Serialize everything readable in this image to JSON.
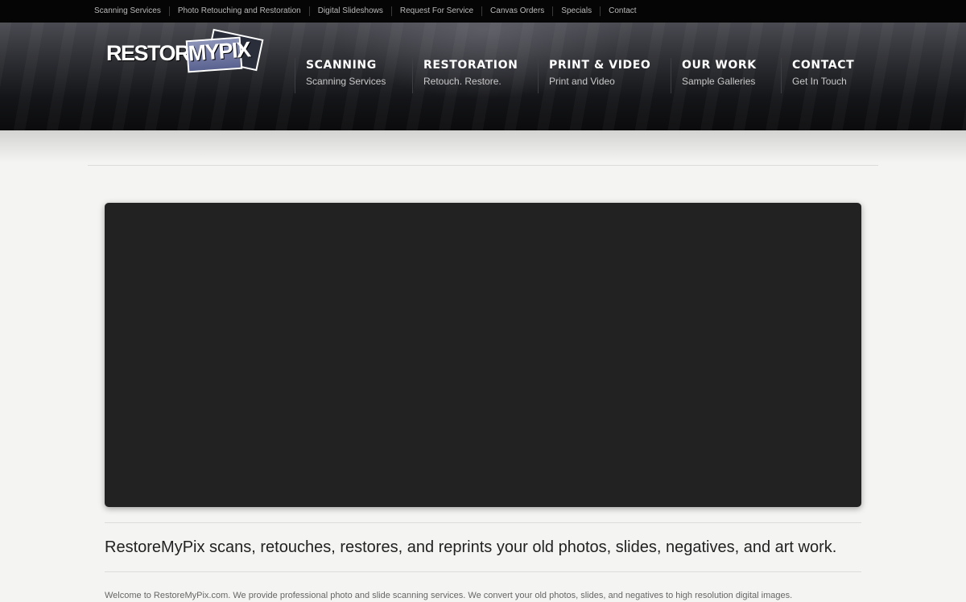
{
  "topbar": {
    "links": [
      "Scanning Services",
      "Photo Retouching and Restoration",
      "Digital Slideshows",
      "Request For Service",
      "Canvas Orders",
      "Specials",
      "Contact"
    ]
  },
  "logo": {
    "word_restore": "RESTORE",
    "word_mypix": "MYPIX"
  },
  "mainnav": {
    "items": [
      {
        "title": "SCANNING",
        "subtitle": "Scanning Services"
      },
      {
        "title": "RESTORATION",
        "subtitle": "Retouch. Restore."
      },
      {
        "title": "PRINT & VIDEO",
        "subtitle": "Print and Video"
      },
      {
        "title": "OUR WORK",
        "subtitle": "Sample Galleries"
      },
      {
        "title": "CONTACT",
        "subtitle": "Get In Touch"
      }
    ]
  },
  "content": {
    "tagline": "RestoreMyPix scans, retouches, restores, and reprints your old photos, slides, negatives, and art work.",
    "intro": "Welcome to RestoreMyPix.com. We provide professional photo and slide scanning services. We convert your old photos, slides, and negatives to high resolution digital images."
  },
  "colors": {
    "topbar_bg": "#050505",
    "header_dark": "#0b0b0d",
    "page_bg": "#f4f4f2",
    "video_bg": "#222222",
    "logo_accent": "#6a72a0"
  }
}
